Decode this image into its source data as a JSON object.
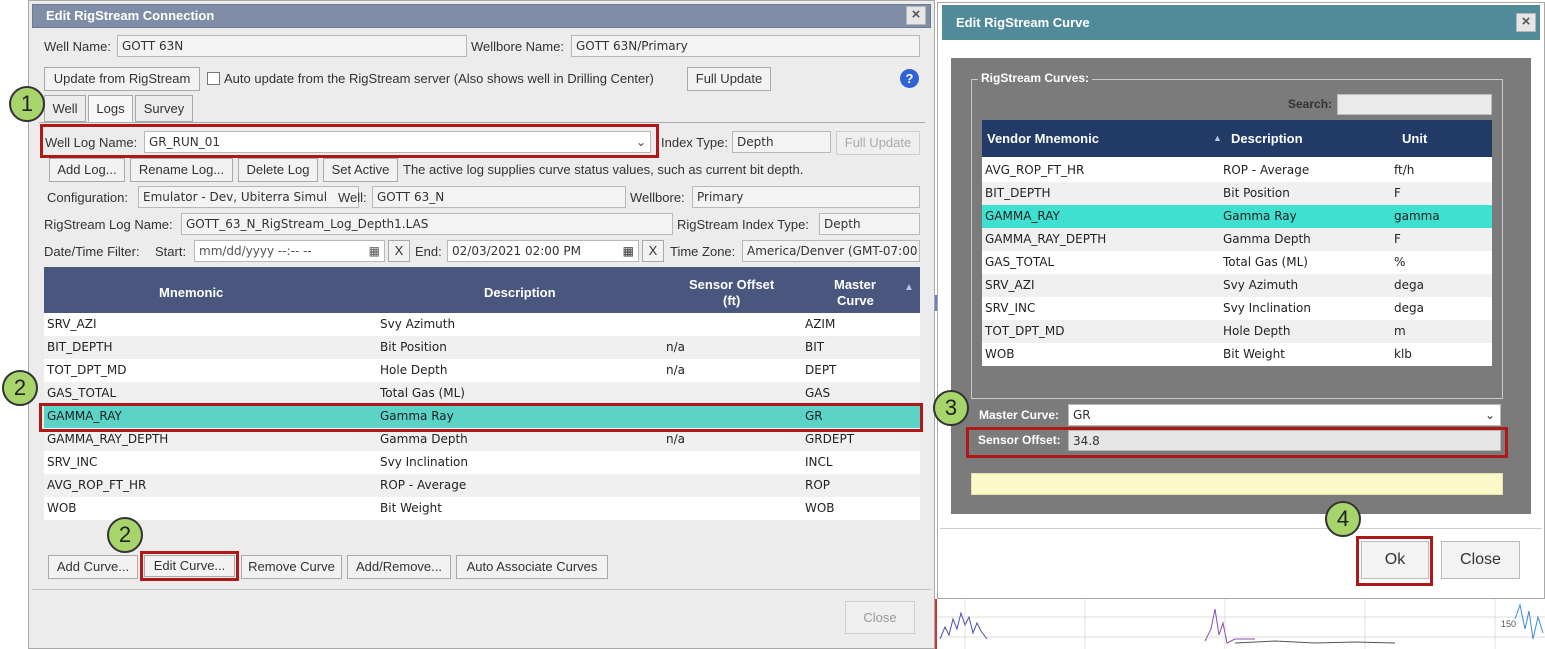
{
  "left_dialog": {
    "title": "Edit RigStream Connection",
    "close_glyph": "×",
    "well_name_label": "Well Name:",
    "well_name_value": "GOTT 63N",
    "wellbore_name_label": "Wellbore Name:",
    "wellbore_name_value": "GOTT 63N/Primary",
    "update_button": "Update from RigStream",
    "auto_update_label": "Auto update from the RigStream server (Also shows well in Drilling Center)",
    "full_update_button": "Full Update",
    "help_glyph": "?",
    "tabs": [
      {
        "label": "Well"
      },
      {
        "label": "Logs"
      },
      {
        "label": "Survey"
      }
    ],
    "well_log_name_label": "Well Log Name:",
    "well_log_name_value": "GR_RUN_01",
    "index_type_label": "Index Type:",
    "index_type_value": "Depth",
    "full_update_disabled": "Full Update",
    "add_log_button": "Add Log...",
    "rename_log_button": "Rename Log...",
    "delete_log_button": "Delete Log",
    "set_active_button": "Set Active",
    "active_log_note": "The active log supplies curve status values, such as current bit depth.",
    "configuration_label": "Configuration:",
    "configuration_value": "Emulator - Dev, Ubiterra Simul",
    "well_label": "Well:",
    "well_value": "GOTT 63_N",
    "wellbore_label": "Wellbore:",
    "wellbore_value": "Primary",
    "rigstream_log_name_label": "RigStream Log Name:",
    "rigstream_log_name_value": "GOTT_63_N_RigStream_Log_Depth1.LAS",
    "rigstream_index_type_label": "RigStream Index Type:",
    "rigstream_index_type_value": "Depth",
    "date_filter_label": "Date/Time Filter:",
    "start_label": "Start:",
    "start_placeholder": "mm/dd/yyyy --:-- --",
    "clear_glyph": "X",
    "end_label": "End:",
    "end_value": "02/03/2021 02:00 PM",
    "time_zone_label": "Time Zone:",
    "time_zone_value": "America/Denver (GMT-07:00",
    "grid": {
      "headers": {
        "mnemonic": "Mnemonic",
        "description": "Description",
        "sensor_offset": "Sensor Offset",
        "sensor_offset_unit": "(ft)",
        "master_curve_1": "Master",
        "master_curve_2": "Curve",
        "sort_glyph": "▲"
      },
      "rows": [
        {
          "mnemonic": "SRV_AZI",
          "description": "Svy Azimuth",
          "offset": "",
          "master": "AZIM"
        },
        {
          "mnemonic": "BIT_DEPTH",
          "description": "Bit Position",
          "offset": "n/a",
          "master": "BIT"
        },
        {
          "mnemonic": "TOT_DPT_MD",
          "description": "Hole Depth",
          "offset": "n/a",
          "master": "DEPT"
        },
        {
          "mnemonic": "GAS_TOTAL",
          "description": "Total Gas (ML)",
          "offset": "",
          "master": "GAS"
        },
        {
          "mnemonic": "GAMMA_RAY",
          "description": "Gamma Ray",
          "offset": "",
          "master": "GR"
        },
        {
          "mnemonic": "GAMMA_RAY_DEPTH",
          "description": "Gamma Depth",
          "offset": "n/a",
          "master": "GRDEPT"
        },
        {
          "mnemonic": "SRV_INC",
          "description": "Svy Inclination",
          "offset": "",
          "master": "INCL"
        },
        {
          "mnemonic": "AVG_ROP_FT_HR",
          "description": "ROP - Average",
          "offset": "",
          "master": "ROP"
        },
        {
          "mnemonic": "WOB",
          "description": "Bit Weight",
          "offset": "",
          "master": "WOB"
        }
      ],
      "selected_row": "GAMMA_RAY"
    },
    "add_curve_button": "Add Curve...",
    "edit_curve_button": "Edit Curve...",
    "remove_curve_button": "Remove Curve",
    "add_remove_button": "Add/Remove...",
    "auto_associate_button": "Auto Associate Curves",
    "close_button": "Close"
  },
  "right_dialog": {
    "title": "Edit RigStream Curve",
    "close_glyph": "×",
    "fieldset_legend": "RigStream Curves:",
    "search_label": "Search:",
    "search_value": "",
    "grid": {
      "headers": {
        "vendor_mnemonic": "Vendor Mnemonic",
        "sort_glyph": "▲",
        "description": "Description",
        "unit": "Unit"
      },
      "rows": [
        {
          "mnemonic": "AVG_ROP_FT_HR",
          "description": "ROP - Average",
          "unit": "ft/h"
        },
        {
          "mnemonic": "BIT_DEPTH",
          "description": "Bit Position",
          "unit": "F"
        },
        {
          "mnemonic": "GAMMA_RAY",
          "description": "Gamma Ray",
          "unit": "gamma"
        },
        {
          "mnemonic": "GAMMA_RAY_DEPTH",
          "description": "Gamma Depth",
          "unit": "F"
        },
        {
          "mnemonic": "GAS_TOTAL",
          "description": "Total Gas (ML)",
          "unit": "%"
        },
        {
          "mnemonic": "SRV_AZI",
          "description": "Svy Azimuth",
          "unit": "dega"
        },
        {
          "mnemonic": "SRV_INC",
          "description": "Svy Inclination",
          "unit": "dega"
        },
        {
          "mnemonic": "TOT_DPT_MD",
          "description": "Hole Depth",
          "unit": "m"
        },
        {
          "mnemonic": "WOB",
          "description": "Bit Weight",
          "unit": "klb"
        }
      ],
      "selected_row": "GAMMA_RAY"
    },
    "master_curve_label": "Master Curve:",
    "master_curve_value": "GR",
    "sensor_offset_label": "Sensor Offset:",
    "sensor_offset_value": "34.8",
    "ok_button": "Ok",
    "close_button": "Close"
  },
  "callouts": [
    "1",
    "2",
    "2",
    "3",
    "4"
  ],
  "background": {
    "chart_tick_label": "150"
  },
  "colors": {
    "selected_row_left": "#5bd3c7",
    "selected_row_right": "#40e0d0",
    "highlight_border": "#b01818",
    "callout_fill": "#a8d56b"
  }
}
